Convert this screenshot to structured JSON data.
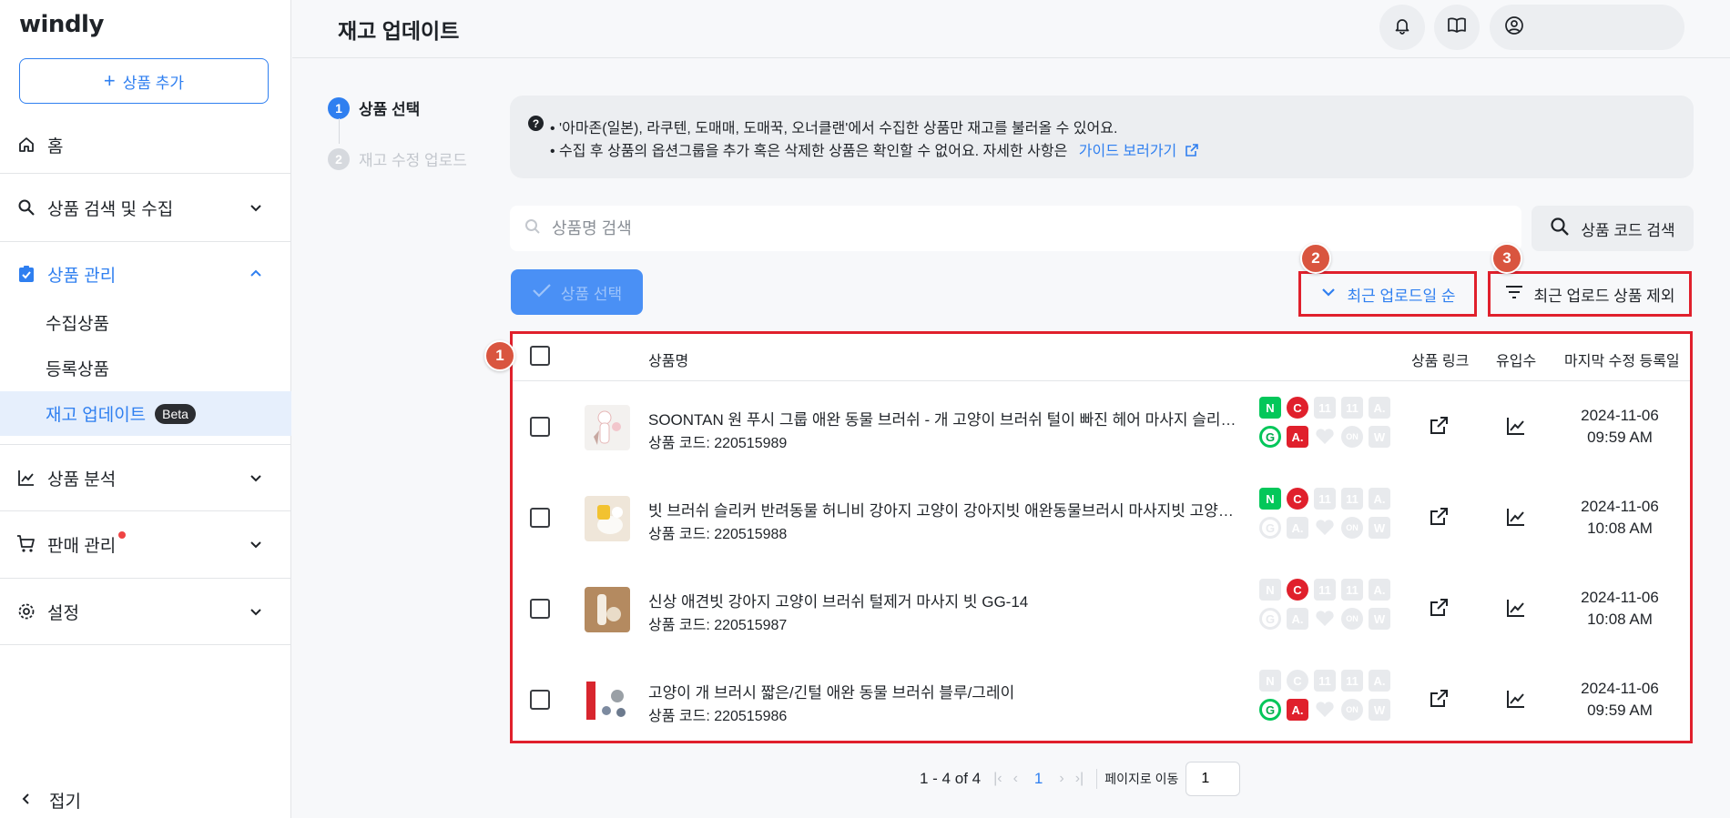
{
  "app": {
    "logo": "windly"
  },
  "sidebar": {
    "add_button": "상품 추가",
    "home": "홈",
    "search_collect": "상품 검색 및 수집",
    "product_mgmt": "상품 관리",
    "sub_collected": "수집상품",
    "sub_registered": "등록상품",
    "sub_stock_update": "재고 업데이트",
    "beta": "Beta",
    "analytics": "상품 분석",
    "sales": "판매 관리",
    "settings": "설정",
    "collapse": "접기"
  },
  "header": {
    "title": "재고 업데이트"
  },
  "stepper": {
    "step1_num": "1",
    "step1": "상품 선택",
    "step2_num": "2",
    "step2": "재고 수정 업로드"
  },
  "info": {
    "line1": "• '아마존(일본), 라쿠텐, 도매매, 도매꾹, 오너클랜'에서 수집한 상품만 재고를 불러올 수 있어요.",
    "line2": "• 수집 후 상품의 옵션그룹을 추가 혹은 삭제한 상품은 확인할 수 없어요. 자세한 사항은",
    "guide_link": "가이드 보러가기"
  },
  "search": {
    "placeholder": "상품명 검색",
    "code_button": "상품 코드 검색"
  },
  "actions": {
    "select_button": "상품 선택",
    "sort_button": "최근 업로드일 순",
    "filter_button": "최근 업로드 상품 제외"
  },
  "badges": {
    "b1": "1",
    "b2": "2",
    "b3": "3"
  },
  "table": {
    "headers": {
      "name": "상품명",
      "link": "상품 링크",
      "views": "유입수",
      "date": "마지막 수정 등록일"
    },
    "rows": [
      {
        "name": "SOONTAN 원 푸시 그룹 애완 동물 브러쉬 - 개 고양이 브러쉬 털이 빠진 헤어 마사지 슬리커 핀 브러쉬 애완동물 미용 용품",
        "code": "상품 코드: 220515989",
        "date": "2024-11-06",
        "time": "09:59 AM"
      },
      {
        "name": "빗 브러쉬 슬리커 반려동물 허니비 강아지 고양이 강아지빗 애완동물브러시 마사지빗 고양이빗 털제거",
        "code": "상품 코드: 220515988",
        "date": "2024-11-06",
        "time": "10:08 AM"
      },
      {
        "name": "신상 애견빗 강아지 고양이 브러쉬 털제거 마사지 빗 GG-14",
        "code": "상품 코드: 220515987",
        "date": "2024-11-06",
        "time": "10:08 AM"
      },
      {
        "name": "고양이 개 브러시 짧은/긴털 애완 동물 브러쉬 블루/그레이",
        "code": "상품 코드: 220515986",
        "date": "2024-11-06",
        "time": "09:59 AM"
      }
    ]
  },
  "markets": {
    "n": "N",
    "c": "C",
    "a": "A.",
    "g": "G",
    "w": "W",
    "on": "ON",
    "lo": "11"
  },
  "pagination": {
    "range": "1 - 4 of 4",
    "current": "1",
    "goto_label": "페이지로 이동",
    "goto_value": "1"
  },
  "colors": {
    "accent": "#2f7ff0",
    "highlight_border": "#e0202c",
    "badge": "#d9553f",
    "naver": "#03c75a",
    "coupang": "#e0202c"
  }
}
